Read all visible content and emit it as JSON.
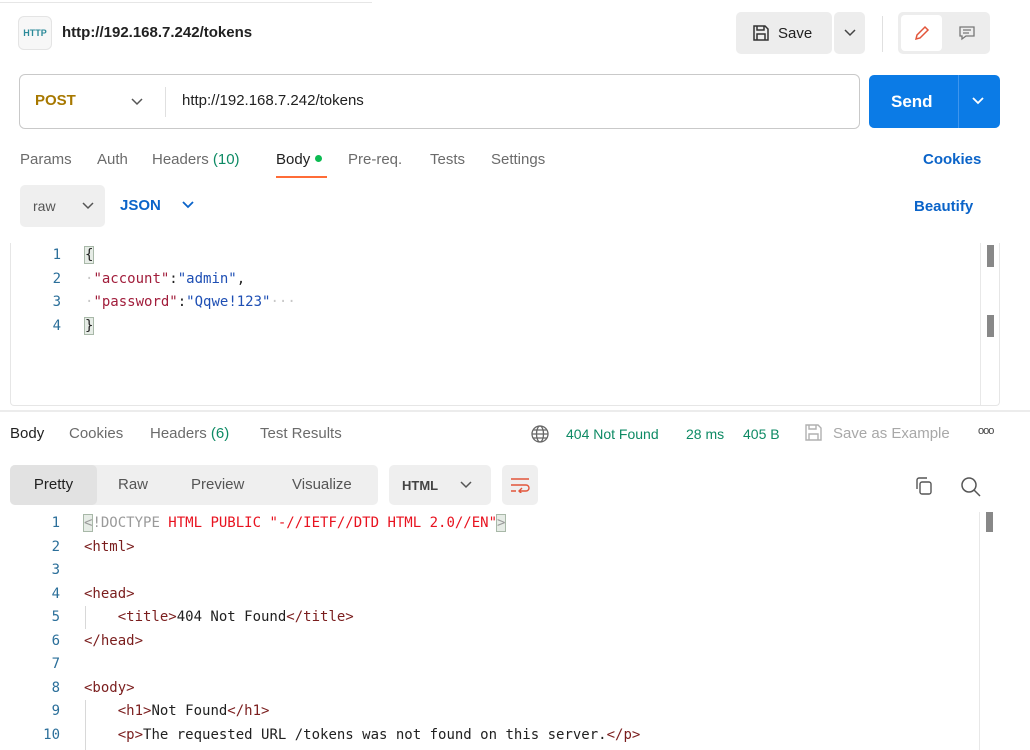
{
  "header": {
    "icon_text": "HTTP",
    "title": "http://192.168.7.242/tokens",
    "save_label": "Save"
  },
  "request": {
    "method": "POST",
    "url": "http://192.168.7.242/tokens",
    "send_label": "Send"
  },
  "request_tabs": [
    {
      "label": "Params"
    },
    {
      "label": "Auth"
    },
    {
      "label": "Headers",
      "count": "(10)"
    },
    {
      "label": "Body",
      "active": true
    },
    {
      "label": "Pre-req."
    },
    {
      "label": "Tests"
    },
    {
      "label": "Settings"
    }
  ],
  "cookies_link": "Cookies",
  "body_options": {
    "mode": "raw",
    "format": "JSON",
    "beautify": "Beautify"
  },
  "request_body": {
    "line_numbers": [
      "1",
      "2",
      "3",
      "4"
    ],
    "lines": [
      [
        {
          "t": "{",
          "c": "p brk"
        }
      ],
      [
        {
          "t": "·",
          "c": "ws"
        },
        {
          "t": "\"account\"",
          "c": "k"
        },
        {
          "t": ":",
          "c": "p"
        },
        {
          "t": "\"admin\"",
          "c": "s"
        },
        {
          "t": ",",
          "c": "p"
        }
      ],
      [
        {
          "t": "·",
          "c": "ws"
        },
        {
          "t": "\"password\"",
          "c": "k"
        },
        {
          "t": ":",
          "c": "p"
        },
        {
          "t": "\"Qqwe!123\"",
          "c": "s"
        },
        {
          "t": "···",
          "c": "ws"
        }
      ],
      [
        {
          "t": "}",
          "c": "p brk"
        }
      ]
    ]
  },
  "response_tabs": [
    {
      "label": "Body",
      "active": true
    },
    {
      "label": "Cookies"
    },
    {
      "label": "Headers",
      "count": "(6)"
    },
    {
      "label": "Test Results"
    }
  ],
  "response_meta": {
    "status": "404 Not Found",
    "time": "28 ms",
    "size": "405 B",
    "save_example": "Save as Example"
  },
  "view_modes": [
    {
      "label": "Pretty",
      "active": true
    },
    {
      "label": "Raw"
    },
    {
      "label": "Preview"
    },
    {
      "label": "Visualize"
    }
  ],
  "response_format": "HTML",
  "response_body": {
    "line_numbers": [
      "1",
      "2",
      "3",
      "4",
      "5",
      "6",
      "7",
      "8",
      "9",
      "10"
    ],
    "lines": [
      [
        {
          "t": "<",
          "c": "dt brk"
        },
        {
          "t": "!DOCTYPE ",
          "c": "dt"
        },
        {
          "t": "HTML PUBLIC \"-//IETF//DTD HTML 2.0//EN\"",
          "c": "dtr"
        },
        {
          "t": ">",
          "c": "dt brk"
        }
      ],
      [
        {
          "t": "<html>",
          "c": "tg"
        }
      ],
      [],
      [
        {
          "t": "<head>",
          "c": "tg"
        }
      ],
      [
        {
          "t": "    <title>",
          "c": "tg"
        },
        {
          "t": "404 Not Found",
          "c": "tx"
        },
        {
          "t": "</title>",
          "c": "tg"
        }
      ],
      [
        {
          "t": "</head>",
          "c": "tg"
        }
      ],
      [],
      [
        {
          "t": "<body>",
          "c": "tg"
        }
      ],
      [
        {
          "t": "    <h1>",
          "c": "tg"
        },
        {
          "t": "Not Found",
          "c": "tx"
        },
        {
          "t": "</h1>",
          "c": "tg"
        }
      ],
      [
        {
          "t": "    <p>",
          "c": "tg"
        },
        {
          "t": "The requested URL /tokens was not found on this server.",
          "c": "tx"
        },
        {
          "t": "</p>",
          "c": "tg"
        }
      ]
    ]
  }
}
